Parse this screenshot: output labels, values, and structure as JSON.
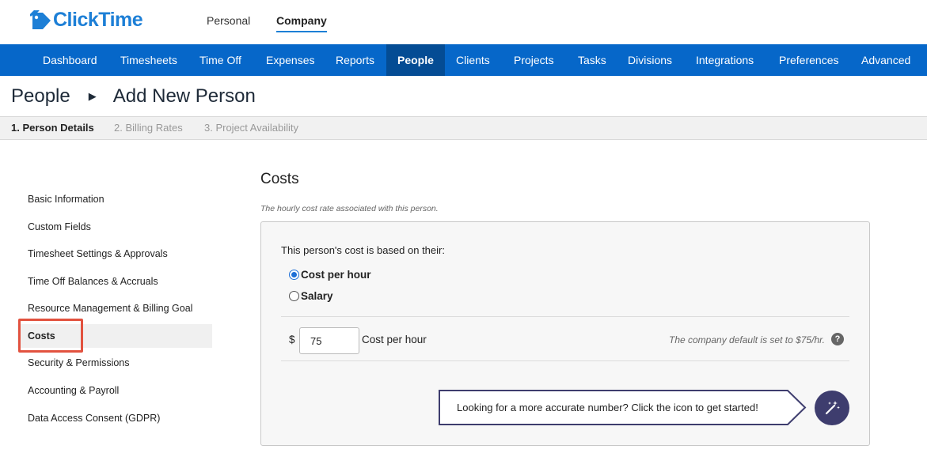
{
  "brand": {
    "name": "ClickTime",
    "logo_icon": "tag-icon",
    "color": "#1d7fd6"
  },
  "mode_tabs": [
    {
      "label": "Personal"
    },
    {
      "label": "Company",
      "active": true
    }
  ],
  "nav": {
    "color": "#0667c9",
    "active_color": "#044c94",
    "items": [
      {
        "label": "Dashboard"
      },
      {
        "label": "Timesheets"
      },
      {
        "label": "Time Off"
      },
      {
        "label": "Expenses"
      },
      {
        "label": "Reports"
      },
      {
        "label": "People",
        "active": true
      },
      {
        "label": "Clients"
      },
      {
        "label": "Projects"
      },
      {
        "label": "Tasks"
      },
      {
        "label": "Divisions"
      },
      {
        "label": "Integrations"
      },
      {
        "label": "Preferences"
      },
      {
        "label": "Advanced"
      }
    ]
  },
  "breadcrumb": {
    "parent": "People",
    "separator_icon": "triangle-right-icon",
    "current": "Add New Person"
  },
  "steps": [
    {
      "label": "1. Person Details",
      "current": true
    },
    {
      "label": "2. Billing Rates"
    },
    {
      "label": "3. Project Availability"
    }
  ],
  "sidebar": {
    "items": [
      {
        "label": "Basic Information"
      },
      {
        "label": "Custom Fields"
      },
      {
        "label": "Timesheet Settings & Approvals"
      },
      {
        "label": "Time Off Balances & Accruals"
      },
      {
        "label": "Resource Management & Billing Goal"
      },
      {
        "label": "Costs",
        "active": true,
        "highlight_color": "#e2523f"
      },
      {
        "label": "Security & Permissions"
      },
      {
        "label": "Accounting & Payroll"
      },
      {
        "label": "Data Access Consent (GDPR)"
      }
    ]
  },
  "costs": {
    "title": "Costs",
    "subtitle": "The hourly cost rate associated with this person.",
    "question": "This person's cost is based on their:",
    "options": [
      {
        "label": "Cost per hour",
        "checked": true
      },
      {
        "label": "Salary",
        "checked": false
      }
    ],
    "currency_symbol": "$",
    "amount_value": "75",
    "amount_unit": "Cost per hour",
    "default_note": "The company default is set to $75/hr.",
    "help_icon": "question-circle-icon",
    "callout_text": "Looking for a more accurate number? Click the icon to get started!",
    "wand_icon": "magic-wand-icon",
    "wand_color": "#3e3d6e"
  }
}
